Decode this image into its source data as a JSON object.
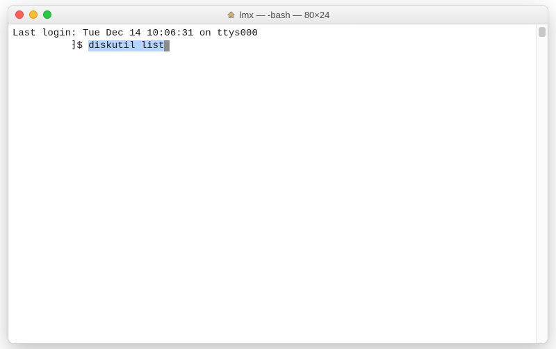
{
  "titlebar": {
    "icon": "home-icon",
    "title": "lmx — -bash — 80×24"
  },
  "terminal": {
    "last_login": "Last login: Tue Dec 14 10:06:31 on ttys000",
    "prompt_suffix": "$ ",
    "prompt_indent": "          ",
    "prompt_glyph": "⁆",
    "command": "diskutil list"
  },
  "colors": {
    "close": "#ff5f57",
    "minimize": "#febc2e",
    "zoom": "#28c840",
    "selection": "#b5d5ff"
  }
}
